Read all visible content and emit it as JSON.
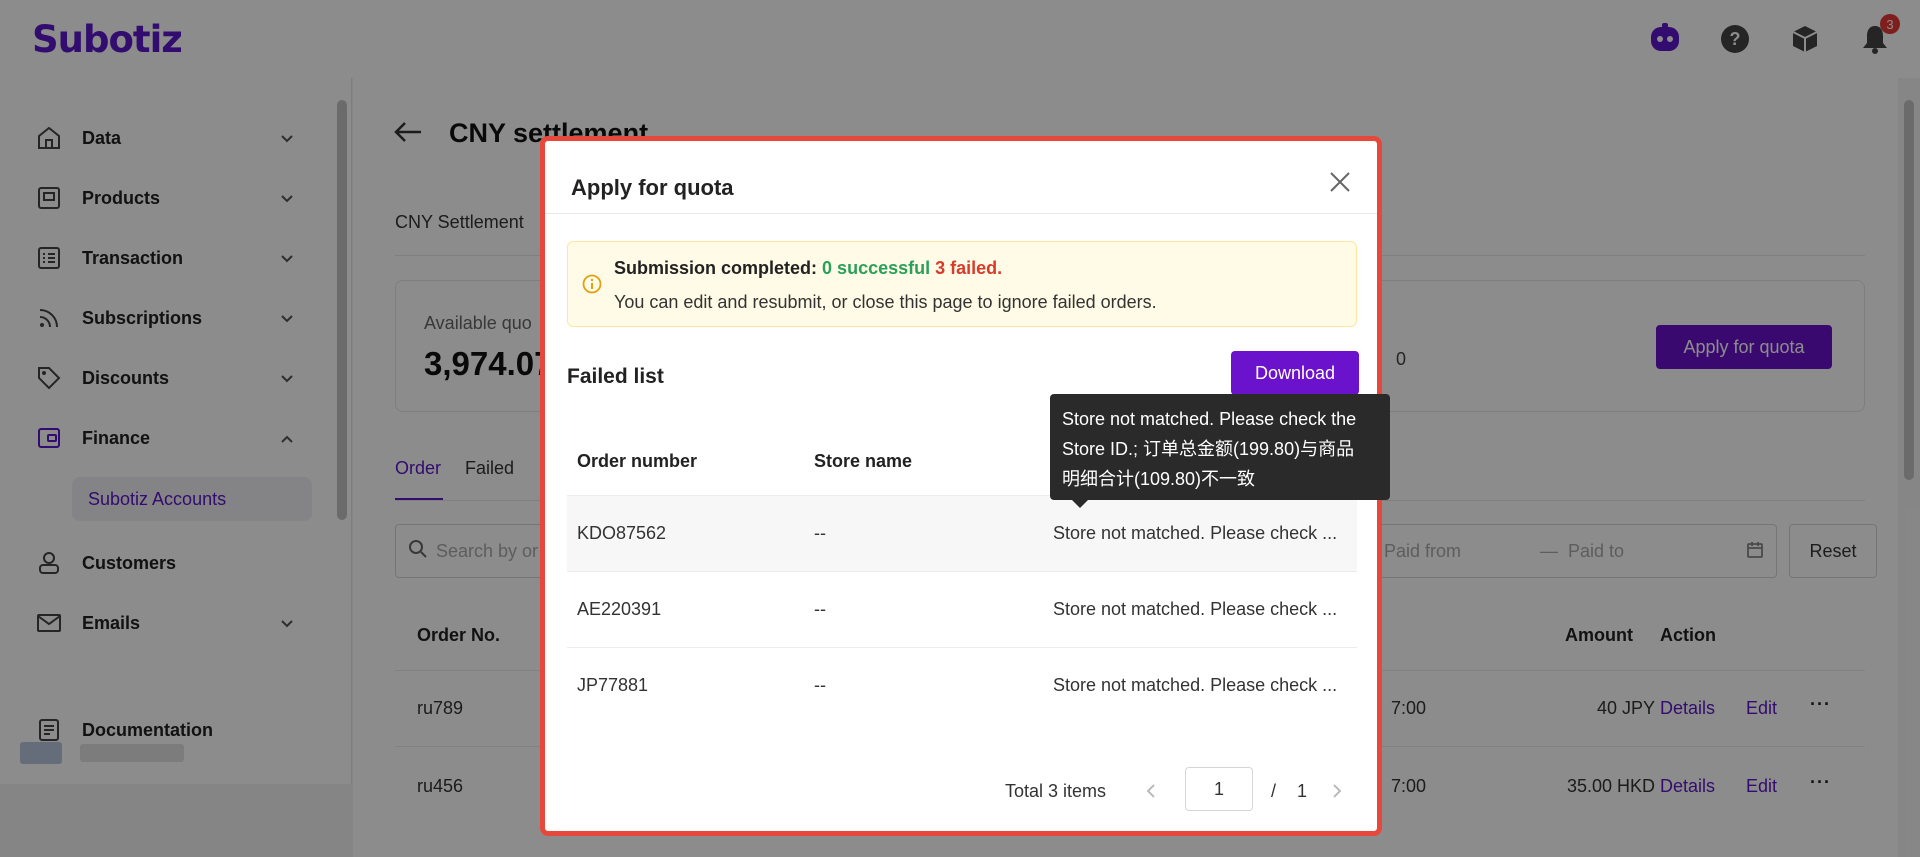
{
  "app": {
    "logo": "Subotiz",
    "notification_count": "3"
  },
  "header_icons": [
    "assistant-bot-icon",
    "help-icon",
    "package-icon",
    "bell-icon"
  ],
  "sidebar": {
    "items": [
      {
        "label": "Data",
        "icon": "home-icon"
      },
      {
        "label": "Products",
        "icon": "box-icon"
      },
      {
        "label": "Transaction",
        "icon": "list-icon"
      },
      {
        "label": "Subscriptions",
        "icon": "rss-icon"
      },
      {
        "label": "Discounts",
        "icon": "tag-icon"
      },
      {
        "label": "Finance",
        "icon": "wallet-icon"
      },
      {
        "label": "Customers",
        "icon": "user-icon"
      },
      {
        "label": "Emails",
        "icon": "mail-icon"
      },
      {
        "label": "Documentation",
        "icon": "document-icon"
      }
    ],
    "sub_item": "Subotiz Accounts"
  },
  "main": {
    "title": "CNY settlement",
    "subtab": "CNY Settlement",
    "quota_label": "Available quo",
    "quota_value": "3,974.07",
    "quota_other": "0",
    "apply_button": "Apply for quota",
    "tabs": [
      "Order",
      "Failed"
    ],
    "search_placeholder": "Search by or",
    "paid_from": "Paid from",
    "paid_to": "Paid to",
    "reset_button": "Reset",
    "table": {
      "headers": {
        "order_no": "Order No.",
        "amount": "Amount",
        "action": "Action"
      },
      "rows": [
        {
          "order": "ru789",
          "time": "7:00",
          "amount": "40 JPY",
          "details": "Details",
          "edit": "Edit"
        },
        {
          "order": "ru456",
          "time": "7:00",
          "amount": "35.00 HKD",
          "details": "Details",
          "edit": "Edit"
        }
      ]
    }
  },
  "modal": {
    "title": "Apply for quota",
    "alert": {
      "prefix": "Submission completed:",
      "success": "0 successful",
      "failed": "3 failed.",
      "detail": "You can edit and resubmit, or close this page to ignore failed orders."
    },
    "failed_list_title": "Failed list",
    "download_button": "Download",
    "headers": {
      "order_number": "Order number",
      "store_name": "Store name"
    },
    "rows": [
      {
        "order": "KDO87562",
        "store": "--",
        "reason": "Store not matched. Please check ..."
      },
      {
        "order": "AE220391",
        "store": "--",
        "reason": "Store not matched. Please check ..."
      },
      {
        "order": "JP77881",
        "store": "--",
        "reason": "Store not matched. Please check ..."
      }
    ],
    "pager": {
      "total": "Total 3 items",
      "current": "1",
      "sep": "/",
      "pages": "1"
    }
  },
  "tooltip": {
    "line1": "Store not matched. Please check the",
    "line2": "Store ID.; 订单总金额(199.80)与商品",
    "line3": "明细合计(109.80)不一致"
  },
  "colors": {
    "brand": "#5b16c9",
    "button": "#6a12cc",
    "success": "#2aa05a",
    "error": "#d83b2b",
    "modal_border": "#e8473c"
  }
}
